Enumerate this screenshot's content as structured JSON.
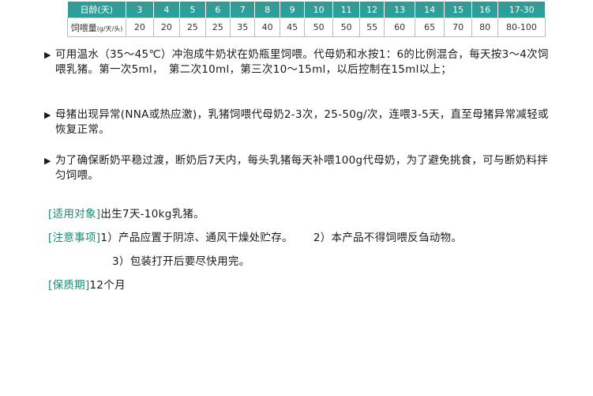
{
  "theme": {
    "header_gradient": [
      "#3f9590",
      "#1fa6a0"
    ],
    "tag_color": "#1a8a6f"
  },
  "table": {
    "age_label": "日龄(天)",
    "amount_label": "饲喂量",
    "amount_unit": "(g/天/头)",
    "ages": [
      "3",
      "4",
      "5",
      "6",
      "7",
      "8",
      "9",
      "10",
      "11",
      "12",
      "13",
      "14",
      "15",
      "16",
      "17-30"
    ],
    "amounts": [
      "20",
      "20",
      "25",
      "25",
      "35",
      "40",
      "45",
      "50",
      "50",
      "55",
      "60",
      "65",
      "70",
      "80",
      "80-100"
    ]
  },
  "instructions": [
    {
      "bullet": "▶",
      "text": "可用温水（35～45℃）冲泡成牛奶状在奶瓶里饲喂。代母奶和水按1：6的比例混合，每天按3～4次饲喂乳猪。第一次5ml，　第二次10ml，第三次10～15ml，以后控制在15ml以上；"
    },
    {
      "bullet": "▶",
      "text": "母猪出现异常(NNA或热应激)，乳猪饲喂代母奶2-3次，25-50g/次，连喂3-5天，直至母猪异常减轻或恢复正常。"
    },
    {
      "bullet": "▶",
      "text": "为了确保断奶平稳过渡，断奶后7天内，每头乳猪每天补喂100g代母奶，为了避免挑食，可与断奶料拌匀饲喂。"
    }
  ],
  "applicable": {
    "tag": "[适用对象]",
    "text": "出生7天-10kg乳猪。"
  },
  "notes": {
    "tag": "[注意事项]",
    "item1": "1）产品应置于阴凉、通风干燥处贮存。",
    "item2": "2）本产品不得饲喂反刍动物。",
    "item3": "3）包装打开后要尽快用完。"
  },
  "shelf_life": {
    "tag": "[保质期]",
    "text": "12个月"
  }
}
